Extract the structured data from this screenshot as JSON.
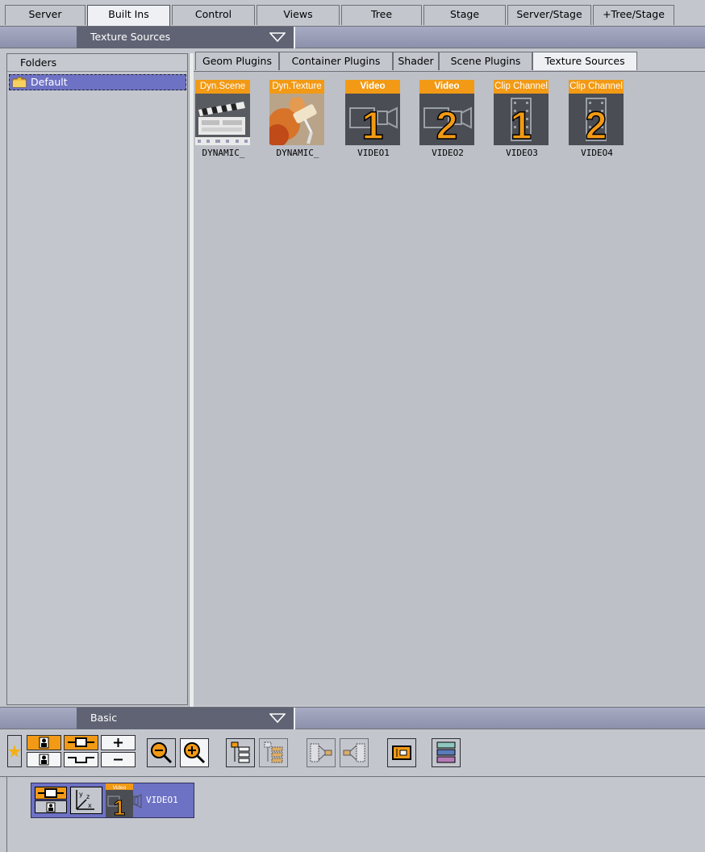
{
  "top_tabs": [
    {
      "label": "Server",
      "active": false
    },
    {
      "label": "Built Ins",
      "active": true
    },
    {
      "label": "Control",
      "active": false
    },
    {
      "label": "Views",
      "active": false
    },
    {
      "label": "Tree",
      "active": false
    },
    {
      "label": "Stage",
      "active": false
    },
    {
      "label": "Server/Stage",
      "active": false
    },
    {
      "label": "+Tree/Stage",
      "active": false
    }
  ],
  "builtins_header": {
    "title": "Texture Sources",
    "dropdown_icon": "chevron-down-icon"
  },
  "folders": {
    "header": "Folders",
    "items": [
      {
        "label": "Default",
        "icon": "folder-icon",
        "selected": true
      }
    ]
  },
  "sub_tabs": [
    {
      "label": "Geom Plugins",
      "active": false
    },
    {
      "label": "Container Plugins",
      "active": false
    },
    {
      "label": "Shader",
      "active": false
    },
    {
      "label": "Scene Plugins",
      "active": false
    },
    {
      "label": "Texture Sources",
      "active": true
    }
  ],
  "texture_sources": [
    {
      "badge": "Dyn.Scene",
      "name": "DYNAMIC_",
      "icon": "clapperboard-icon"
    },
    {
      "badge": "Dyn.Texture",
      "name": "DYNAMIC_",
      "icon": "paint-roller-icon"
    },
    {
      "badge": "Video",
      "name": "VIDEO1",
      "number": "1",
      "icon": "video-camera-icon"
    },
    {
      "badge": "Video",
      "name": "VIDEO2",
      "number": "2",
      "icon": "video-camera-icon"
    },
    {
      "badge": "Clip Channel",
      "name": "VIDEO3",
      "number": "1",
      "icon": "film-strip-icon"
    },
    {
      "badge": "Clip Channel",
      "name": "VIDEO4",
      "number": "2",
      "icon": "film-strip-icon"
    }
  ],
  "basic_header": {
    "title": "Basic",
    "dropdown_icon": "chevron-down-icon"
  },
  "scene_tree": {
    "item": {
      "name": "VIDEO1",
      "badge": "Video",
      "number": "1"
    }
  },
  "colors": {
    "accent_orange": "#f29a15",
    "selection_purple": "#6e72c4",
    "header_dark": "#5f6373",
    "background": "#c3c6cd"
  }
}
